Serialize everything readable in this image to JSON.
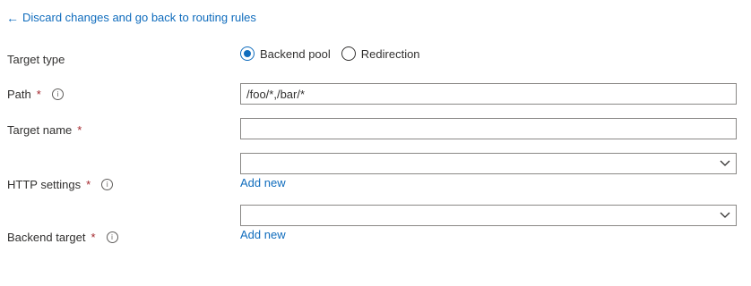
{
  "back_link": {
    "arrow": "←",
    "label": "Discard changes and go back to routing rules"
  },
  "form": {
    "target_type": {
      "label": "Target type",
      "options": [
        {
          "label": "Backend pool",
          "checked": true
        },
        {
          "label": "Redirection",
          "checked": false
        }
      ]
    },
    "path": {
      "label": "Path",
      "required_mark": "*",
      "value": "/foo/*,/bar/*"
    },
    "target_name": {
      "label": "Target name",
      "required_mark": "*",
      "value": ""
    },
    "http_settings": {
      "label": "HTTP settings",
      "required_mark": "*",
      "selected": "",
      "add_new_label": "Add new"
    },
    "backend_target": {
      "label": "Backend target",
      "required_mark": "*",
      "selected": "",
      "add_new_label": "Add new"
    }
  },
  "colors": {
    "link": "#0f6cbd",
    "required": "#a4262c",
    "text": "#323130",
    "border": "#8a8886"
  },
  "icons": {
    "info": "info-icon",
    "chevron": "chevron-down-icon",
    "back": "arrow-left-icon"
  }
}
